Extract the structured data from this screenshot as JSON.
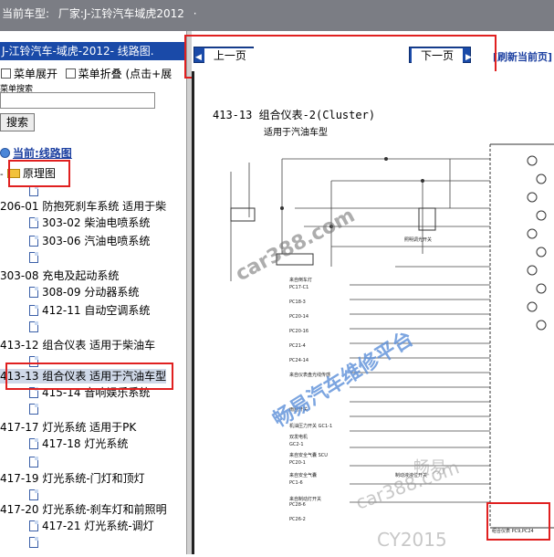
{
  "topbar": {
    "model_label": "当前车型:",
    "maker_text": "厂家:J-江铃汽车域虎2012",
    "dot": "·"
  },
  "left_panel": {
    "title": "J-江铃汽车-域虎-2012- 线路图.",
    "expand_label": "菜单展开",
    "collapse_label": "菜单折叠 (点击+展",
    "search_label": "菜单搜索",
    "search_value": "",
    "search_button": "搜索",
    "tree": {
      "current_label": "当前:线路图",
      "root_label": "原理图",
      "items": [
        {
          "label": "206-01 防抱死刹车系统 适用于柴",
          "level": 0
        },
        {
          "label": "303-02 柴油电喷系统",
          "level": 1
        },
        {
          "label": "303-06 汽油电喷系统",
          "level": 1
        },
        {
          "label": "303-08 充电及起动系统",
          "level": 0
        },
        {
          "label": "308-09 分动器系统",
          "level": 1
        },
        {
          "label": "412-11 自动空调系统",
          "level": 1
        },
        {
          "label": "413-12 组合仪表 适用于柴油车",
          "level": 0
        },
        {
          "label": "413-13 组合仪表 适用于汽油车型",
          "level": 0
        },
        {
          "label": "415-14 音响娱乐系统",
          "level": 1
        },
        {
          "label": "417-17 灯光系统 适用于PK",
          "level": 0
        },
        {
          "label": "417-18 灯光系统",
          "level": 1
        },
        {
          "label": "417-19 灯光系统-门灯和顶灯",
          "level": 0
        },
        {
          "label": "417-20 灯光系统-刹车灯和前照明",
          "level": 0
        },
        {
          "label": "417-21 灯光系统-调灯",
          "level": 1
        }
      ]
    }
  },
  "viewer": {
    "prev_button": "上一页",
    "next_button": "下一页",
    "refresh_label": "[刷新当前页]",
    "diagram_title": "413-13 组合仪表-2(Cluster)",
    "diagram_subtitle": "适用于汽油车型",
    "diagram_footer": "组合仪表 PC9,PC24",
    "watermarks": [
      "car388.com",
      "畅易汽车维修平台",
      "畅易",
      "car388.com",
      "CY2015"
    ],
    "wire_labels": [
      "来自倒车灯",
      "PC17-C1",
      "PC18-3",
      "PC20-14",
      "PC20-16",
      "PC21-4",
      "PC24-14",
      "来自仪表盘光线传感",
      "来自安全气囊 SCU",
      "PC20-1",
      "PC28-6",
      "雨刮开关",
      "来自安全气囊",
      "PC1-6",
      "机油压力开关 GC1-1",
      "双发电机",
      "GC2-1",
      "照明调光开关",
      "制动液液位开关",
      "来自制动灯开关",
      "PC26-2"
    ],
    "colors": {
      "topbar": "#7b7d84",
      "title_bg": "#1a4aa8",
      "link": "#1a3ea0",
      "highlight_box": "#e02020",
      "watermark": "#5b8fd8"
    }
  }
}
